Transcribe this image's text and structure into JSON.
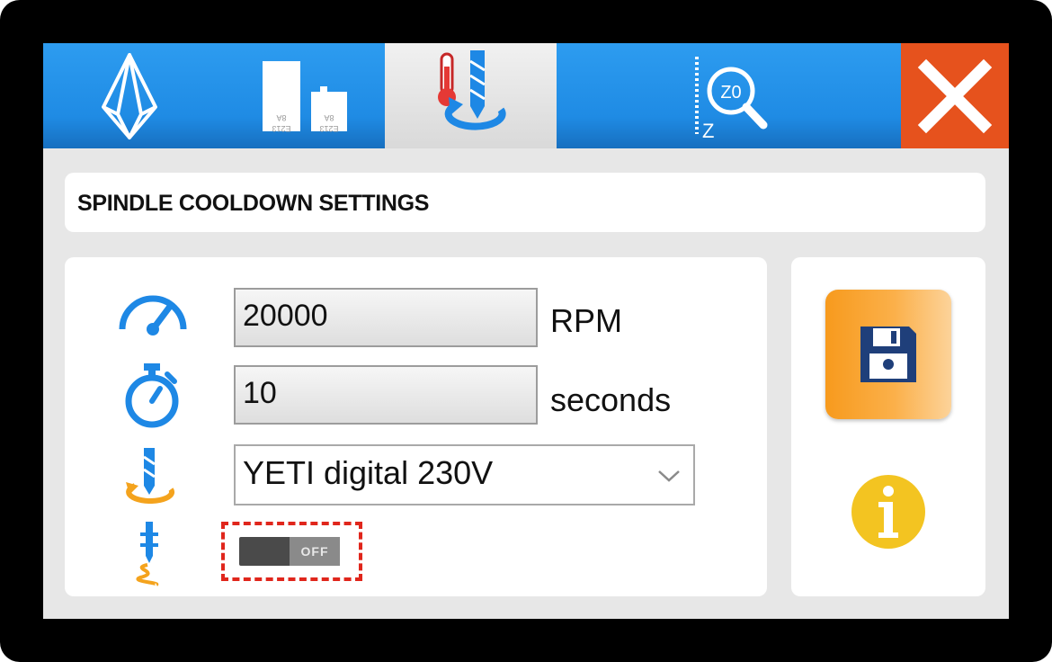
{
  "toolbar": {
    "tabs": [
      {
        "name": "home-logo-tab",
        "icon": "yeti-logo-icon"
      },
      {
        "name": "material-tab",
        "icon": "material-blocks-icon",
        "labels": [
          "8A\nE213",
          "8A\nE213"
        ]
      },
      {
        "name": "spindle-cooldown-tab",
        "icon": "spindle-temperature-icon",
        "active": true
      },
      {
        "name": "z-zero-tab",
        "icon": "z-zero-probe-icon",
        "label": "Z0",
        "axis": "Z"
      },
      {
        "name": "close-tab",
        "icon": "close-icon"
      }
    ]
  },
  "title": "SPINDLE COOLDOWN SETTINGS",
  "settings": {
    "speed": {
      "icon": "speedometer-icon",
      "value": "20000",
      "unit": "RPM"
    },
    "duration": {
      "icon": "stopwatch-icon",
      "value": "10",
      "unit": "seconds"
    },
    "spindle": {
      "icon": "spindle-rotate-icon",
      "selected": "YETI digital 230V"
    },
    "toggle": {
      "icon": "spindle-vibration-icon",
      "state": "OFF"
    }
  },
  "actions": {
    "save_icon": "floppy-disk-icon",
    "info_icon": "info-icon"
  },
  "colors": {
    "toolbar_blue": "#2196f3",
    "close_orange": "#e6521d",
    "save_orange": "#f79a1d",
    "info_yellow": "#f3c421",
    "icon_blue": "#1e88e5",
    "highlight_red": "#e0261c"
  }
}
